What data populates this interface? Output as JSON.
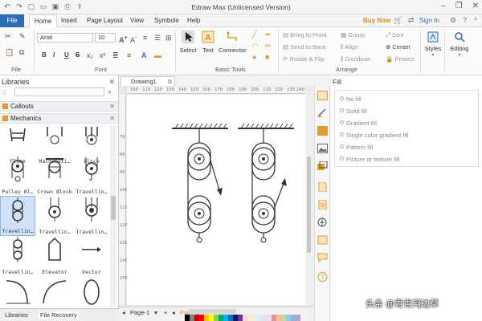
{
  "window": {
    "title": "Edraw Max (Unlicensed Version)",
    "controls": [
      "minimize-icon",
      "restore-icon",
      "close-icon"
    ]
  },
  "menu": {
    "tabs": [
      "File",
      "Home",
      "Insert",
      "Page Layout",
      "View",
      "Symbols",
      "Help"
    ],
    "buy_now": "Buy Now",
    "sign_in": "Sign In"
  },
  "ribbon": {
    "font_name": "Arial",
    "font_size": "10",
    "format_buttons": [
      "B",
      "I",
      "U",
      "S"
    ],
    "group_labels": {
      "file": "File",
      "font": "Font",
      "basic_tools": "Basic Tools",
      "arrange": "Arrange"
    },
    "tools": {
      "select": "Select",
      "text": "Text",
      "connector": "Connector"
    },
    "arrange_items": [
      "Bring to Front",
      "Send to Back",
      "Rotate & Flip",
      "Group",
      "Align",
      "Distribute",
      "Size",
      "Center",
      "Protect"
    ],
    "styles": "Styles",
    "editing": "Editing"
  },
  "libraries": {
    "title": "Libraries",
    "categories": [
      "Callouts",
      "Mechanics"
    ],
    "shapes": [
      {
        "label": "Flume"
      },
      {
        "label": "Mathemati…"
      },
      {
        "label": "Block"
      },
      {
        "label": "Pulley Bl…"
      },
      {
        "label": "Crown Block"
      },
      {
        "label": "Travellin…"
      },
      {
        "label": "Travellin…"
      },
      {
        "label": "Travellin…"
      },
      {
        "label": "Travellin…"
      },
      {
        "label": "Travellin…"
      },
      {
        "label": "Elevator"
      },
      {
        "label": "Vector"
      }
    ],
    "bottom_tabs": [
      "Libraries",
      "File Recovery"
    ]
  },
  "document": {
    "tab": "Drawing1",
    "ruler_h": [
      "100",
      "110",
      "120",
      "130",
      "140",
      "150",
      "160",
      "170",
      "180",
      "190",
      "200",
      "210",
      "220",
      "230",
      "240"
    ],
    "ruler_v": [
      "70",
      "80",
      "90",
      "100",
      "110",
      "120",
      "130",
      "140",
      "150"
    ],
    "page_name": "Page-1",
    "page_tab": "Page-1"
  },
  "fill": {
    "title": "Fill",
    "options": [
      "No fill",
      "Solid fill",
      "Gradient fill",
      "Single color gradient fill",
      "Pattern fill",
      "Picture or texture fill"
    ]
  },
  "watermark": "头条 @青青河边草",
  "colors": {
    "accent": "#2d6db5",
    "orange": "#e39b2b",
    "palette": [
      "#000000",
      "#7f7f7f",
      "#c00000",
      "#ff0000",
      "#ffc000",
      "#ffff00",
      "#92d050",
      "#00b050",
      "#00b0f0",
      "#0070c0",
      "#002060",
      "#7030a0",
      "#f2dcdb",
      "#fde9d9",
      "#ebf1dd",
      "#dbeef3",
      "#dce6f1",
      "#e5e0ec",
      "#d99694",
      "#fac08f",
      "#c3d69b",
      "#93cddd",
      "#95b3d7",
      "#b2a2c7"
    ]
  }
}
